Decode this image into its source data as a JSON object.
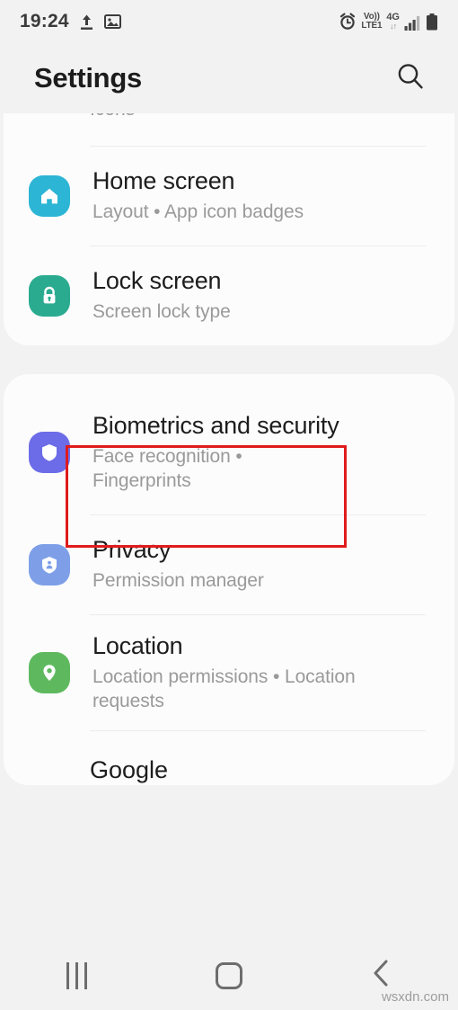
{
  "status_bar": {
    "time": "19:24",
    "left_icons": [
      "upload-icon",
      "image-icon"
    ],
    "volte_line1": "Vo))",
    "volte_line2": "LTE1",
    "network": "4G",
    "data_arrows": "↓↑",
    "right_icons": [
      "alarm-icon",
      "volte-icon",
      "network-4g-icon",
      "signal-icon",
      "battery-icon"
    ]
  },
  "header": {
    "title": "Settings",
    "search_icon": "search-icon"
  },
  "cards": [
    {
      "partial_top_text": "Icons",
      "items": [
        {
          "title": "Home screen",
          "subtitle": "Layout  •  App icon badges",
          "icon": "home-icon",
          "icon_color": "#2cb5d4"
        },
        {
          "title": "Lock screen",
          "subtitle": "Screen lock type",
          "icon": "lock-icon",
          "icon_color": "#2aab8f"
        }
      ]
    },
    {
      "items": [
        {
          "title": "Biometrics and security",
          "subtitle": "Face recognition  •  Fingerprints",
          "icon": "shield-icon",
          "icon_color": "#6c6ce8",
          "highlighted": true
        },
        {
          "title": "Privacy",
          "subtitle": "Permission manager",
          "icon": "privacy-shield-person-icon",
          "icon_color": "#7e9fe8"
        },
        {
          "title": "Location",
          "subtitle": "Location permissions  •  Location requests",
          "icon": "location-pin-icon",
          "icon_color": "#5eb95e"
        }
      ],
      "partial_bottom_text": "Google"
    }
  ],
  "highlight": {
    "color": "#e01b1b"
  },
  "nav_bar": {
    "recents_label": "recents-button",
    "home_label": "home-button",
    "back_label": "back-button"
  },
  "watermark": "wsxdn.com"
}
